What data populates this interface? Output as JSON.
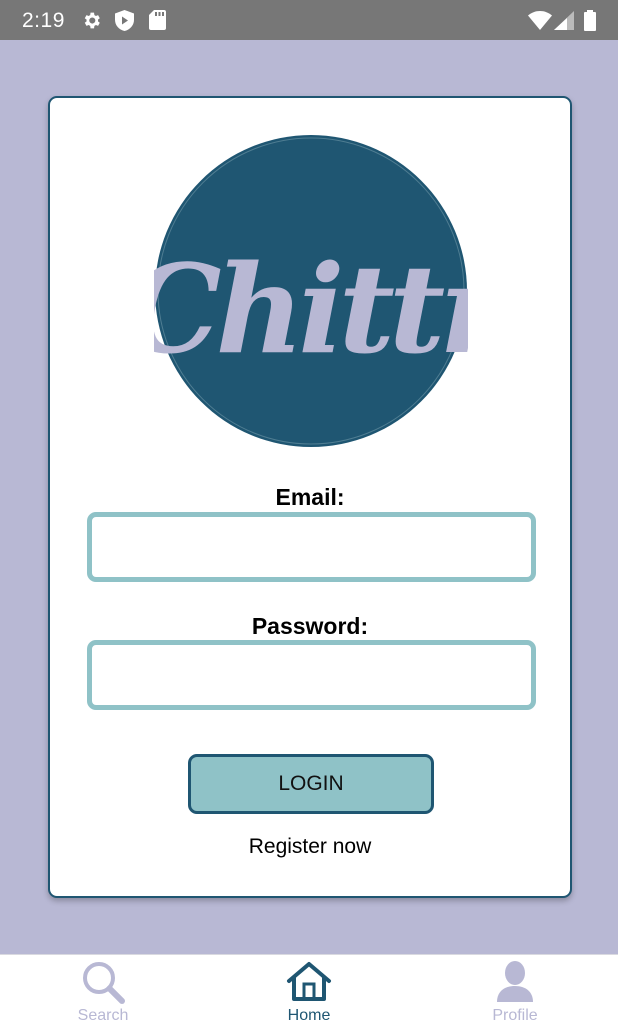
{
  "status_bar": {
    "time": "2:19",
    "icons": [
      "gear-icon",
      "shield-icon",
      "sd-card-icon",
      "wifi-icon",
      "signal-icon",
      "battery-icon"
    ]
  },
  "logo": {
    "text": "Chittr",
    "circle_color": "#1f5672",
    "text_color": "#b8b8d4"
  },
  "form": {
    "email_label": "Email:",
    "email_value": "",
    "password_label": "Password:",
    "password_value": "",
    "login_label": "LOGIN",
    "register_label": "Register now"
  },
  "tabs": [
    {
      "label": "Search",
      "icon": "search-icon",
      "active": false
    },
    {
      "label": "Home",
      "icon": "home-icon",
      "active": true
    },
    {
      "label": "Profile",
      "icon": "person-icon",
      "active": false
    }
  ],
  "colors": {
    "background": "#b8b8d4",
    "primary": "#1f5672",
    "accent": "#8fc2c7",
    "status_bar": "#777777",
    "inactive_tab": "#b8b8d4"
  }
}
